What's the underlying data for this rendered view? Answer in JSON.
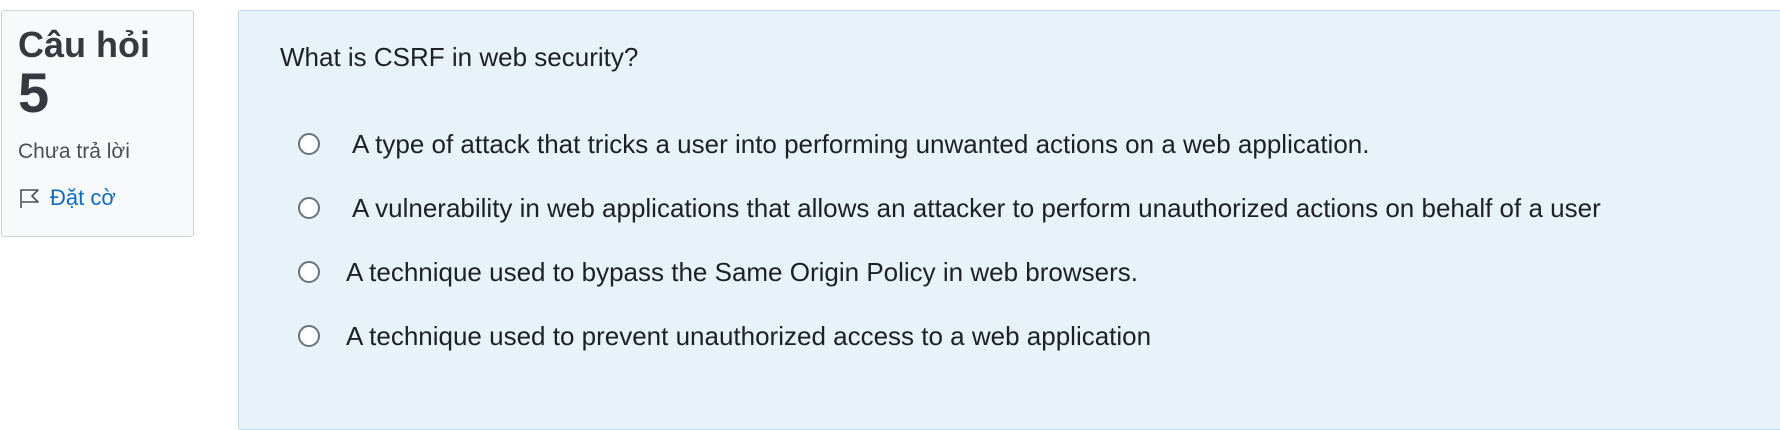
{
  "info": {
    "label": "Câu hỏi",
    "number": "5",
    "state": "Chưa trả lời",
    "flag_label": "Đặt cờ"
  },
  "question": {
    "text": "What is CSRF in web security?",
    "answers": [
      {
        "text": "A type of attack that tricks a user into performing unwanted actions on a web application."
      },
      {
        "text": "A vulnerability in web applications that allows an attacker to perform unauthorized actions on behalf of a user"
      },
      {
        "text": "A technique used to bypass the Same Origin Policy in web browsers."
      },
      {
        "text": "A technique used to prevent unauthorized access to a web application"
      }
    ]
  },
  "colors": {
    "info_background": "#f8f9fa",
    "content_background": "#e7f3f9",
    "link": "#0f6cbf"
  }
}
